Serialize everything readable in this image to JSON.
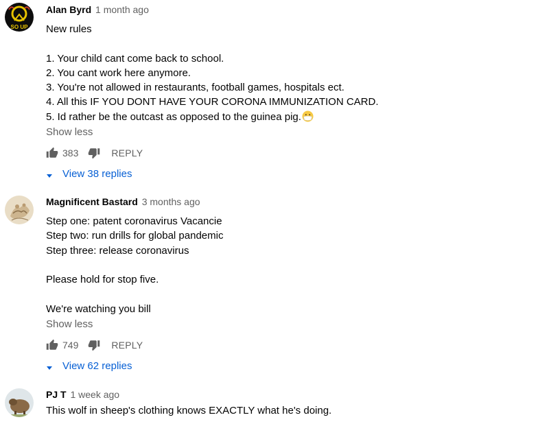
{
  "comments": [
    {
      "author": "Alan Byrd",
      "time": "1 month ago",
      "lines": [
        "New rules",
        "",
        "1. Your child cant come back to school.",
        "2. You cant work here anymore.",
        "3. You're not allowed in restaurants, football games,  hospitals ect.",
        "4. All this IF YOU DONT HAVE YOUR CORONA IMMUNIZATION CARD.",
        "5. Id rather be the outcast as opposed to the guinea pig."
      ],
      "emoji_icon": "mask-face-emoji",
      "show_less": "Show less",
      "likes": "383",
      "reply": "REPLY",
      "view_replies": "View 38 replies"
    },
    {
      "author": "Magnificent Bastard",
      "time": "3 months ago",
      "lines": [
        "Step one: patent coronavirus Vacancie",
        "Step two: run drills for global pandemic",
        "Step three: release coronavirus",
        "",
        "Please hold for stop five.",
        "",
        "We're watching you bill"
      ],
      "show_less": "Show less",
      "likes": "749",
      "reply": "REPLY",
      "view_replies": "View 62 replies"
    },
    {
      "author": "PJ T",
      "time": "1 week ago",
      "lines": [
        "This wolf in sheep's clothing knows EXACTLY what he's doing."
      ]
    }
  ],
  "icons": {
    "like": "thumbs-up-icon",
    "dislike": "thumbs-down-icon",
    "expand": "caret-down-icon"
  },
  "colors": {
    "link": "#065fd4",
    "secondary_text": "#606060",
    "primary_text": "#030303"
  }
}
